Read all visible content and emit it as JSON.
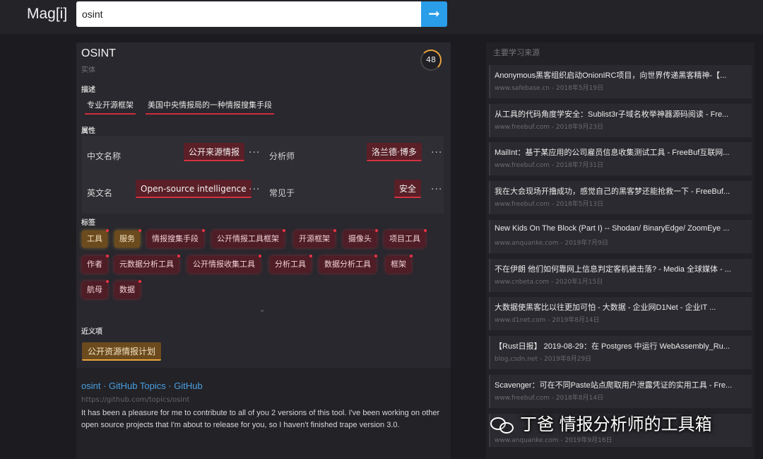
{
  "header": {
    "logo": "Mag[i]",
    "search_value": "osint",
    "search_button_icon": "arrow-right-icon"
  },
  "entity": {
    "title": "OSINT",
    "type": "实体",
    "score": "48",
    "desc_label": "描述",
    "descriptions": [
      "专业开源框架",
      "美国中央情报局的一种情报搜集手段"
    ],
    "attr_label": "属性",
    "attr_hint": "",
    "attributes": [
      {
        "label": "中文名称",
        "value": "公开来源情报"
      },
      {
        "label": "分析师",
        "value": "洛兰德·博多"
      },
      {
        "label": "英文名",
        "value": "Open-source intelligence"
      },
      {
        "label": "常见于",
        "value": "安全"
      }
    ],
    "tags_label": "标签",
    "tags_hint": "",
    "tags": [
      "工具",
      "服务",
      "情报搜集手段",
      "公开情报工具框架",
      "开源框架",
      "摄像头",
      "项目工具",
      "作者",
      "元数据分析工具",
      "公开情报收集工具",
      "分析工具",
      "数据分析工具",
      "框架",
      "航母",
      "数据"
    ],
    "synonyms_label": "近义项",
    "synonyms": [
      "公开资源情报计划"
    ]
  },
  "result": {
    "title": "osint · GitHub Topics · GitHub",
    "url": "https://github.com/topics/osint",
    "snippet": "It has been a pleasure for me to contribute to all of you 2 versions of this tool. I've been working on other open source projects that I'm about to release for you, so I haven't finished trape version 3.0."
  },
  "sidebar": {
    "heading": "主要学习来源",
    "items": [
      {
        "title": "Anonymous黑客组织启动OnionIRC项目，向世界传递黑客精神-【...",
        "source": "www.safebase.cn",
        "date": "2018年5月19日"
      },
      {
        "title": "从工具的代码角度学安全：Sublist3r子域名枚举神器源码阅读 - Fre...",
        "source": "www.freebuf.com",
        "date": "2018年9月23日"
      },
      {
        "title": "MailInt：基于某应用的公司雇员信息收集测试工具 - FreeBuf互联网...",
        "source": "www.freebuf.com",
        "date": "2018年7月31日"
      },
      {
        "title": "我在大会现场开撸成功，感觉自己的黑客梦还能抢救一下 - FreeBuf...",
        "source": "www.freebuf.com",
        "date": "2018年5月13日"
      },
      {
        "title": "New Kids On The Block (Part I) -- Shodan/ BinaryEdge/ ZoomEye ...",
        "source": "www.anquanke.com",
        "date": "2019年7月9日"
      },
      {
        "title": "不在伊朗 他们如何靠网上信息判定客机被击落? - Media 全球媒体 - ...",
        "source": "www.cnbeta.com",
        "date": "2020年1月15日"
      },
      {
        "title": "大数据使黑客比以往更加可怕 - 大数据 - 企业网D1Net - 企业IT ...",
        "source": "www.d1net.com",
        "date": "2019年8月14日"
      },
      {
        "title": "【Rust日报】 2019-08-29：在 Postgres 中运行 WebAssembly_Ru...",
        "source": "blog.csdn.net",
        "date": "2019年8月29日"
      },
      {
        "title": "Scavenger：可在不同Paste站点爬取用户泄露凭证的实用工具 - Fre...",
        "source": "www.freebuf.com",
        "date": "2018年8月14日"
      },
      {
        "title": "",
        "source": "www.anquanke.com",
        "date": "2019年9月16日"
      }
    ]
  },
  "watermark": {
    "text": "丁爸 情报分析师的工具箱",
    "icon": "wechat-icon"
  },
  "colors": {
    "accent_red": "#d2323f",
    "accent_gold": "#e8a33c",
    "link": "#4a9fe0",
    "search_button": "#2a9ee9"
  }
}
